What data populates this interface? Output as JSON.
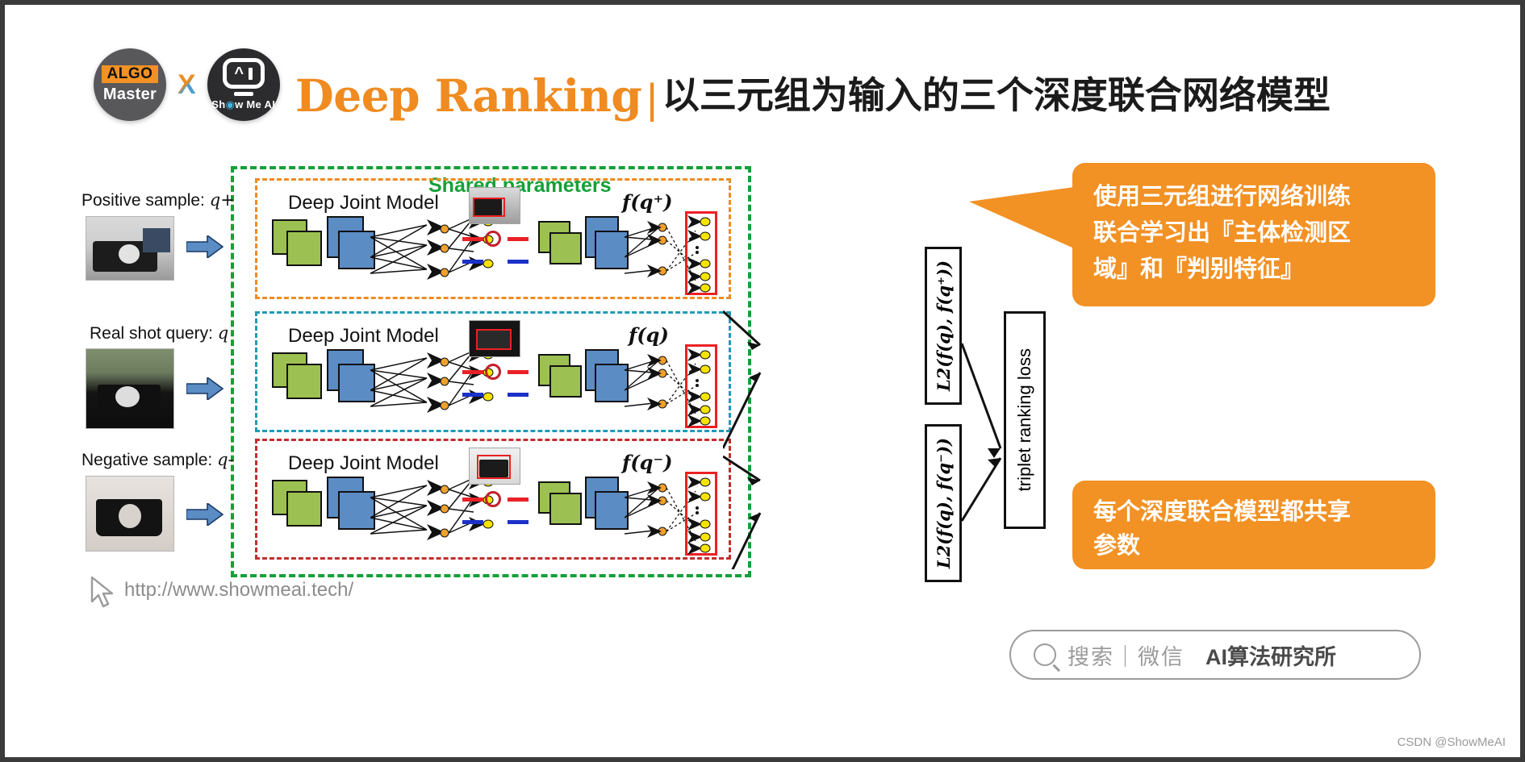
{
  "header": {
    "logo_left": {
      "top": "ALGO",
      "bottom": "Master"
    },
    "logo_x": "X",
    "logo_right": {
      "brand": "Show Me AI"
    },
    "title_en": "Deep Ranking",
    "title_separator": "|",
    "title_cn": "以三元组为输入的三个深度联合网络模型"
  },
  "diagram": {
    "shared_parameters_label": "Shared parameters",
    "rows": [
      {
        "sample_label": "Positive sample:",
        "sample_symbol": "q+",
        "model_label": "Deep Joint Model",
        "output_label": "f(q⁺)"
      },
      {
        "sample_label": "Real shot query:",
        "sample_symbol": "q",
        "model_label": "Deep Joint Model",
        "output_label": "f(q)"
      },
      {
        "sample_label": "Negative sample:",
        "sample_symbol": "q-",
        "model_label": "Deep Joint Model",
        "output_label": "f(q⁻)"
      }
    ],
    "l2_top": "L2(f(q), f(q⁺))",
    "l2_bottom": "L2(f(q), f(q⁻))",
    "loss_box": "triplet ranking loss"
  },
  "callouts": {
    "one": "使用三元组进行网络训练联合学习出『主体检测区域』和『判别特征』",
    "one_lines": [
      "使用三元组进行网络训练",
      "联合学习出『主体检测区",
      "域』和『判别特征』"
    ],
    "two": "每个深度联合模型都共享参数",
    "two_lines": [
      "每个深度联合模型都共享",
      "参数"
    ]
  },
  "search_pill": {
    "icon": "search-icon",
    "text": "搜索｜微信",
    "brand": "AI算法研究所"
  },
  "footer": {
    "url": "http://www.showmeai.tech/",
    "watermark": "CSDN @ShowMeAI"
  },
  "colors": {
    "accent_orange": "#f29124",
    "brand_dark": "#3b3b3b",
    "green_dashed": "#14a038",
    "box_orange": "#ef8b20",
    "box_teal": "#1f9bb5",
    "box_red": "#c22d2d",
    "node_green": "#9cc152",
    "node_blue": "#5b8cc4"
  }
}
